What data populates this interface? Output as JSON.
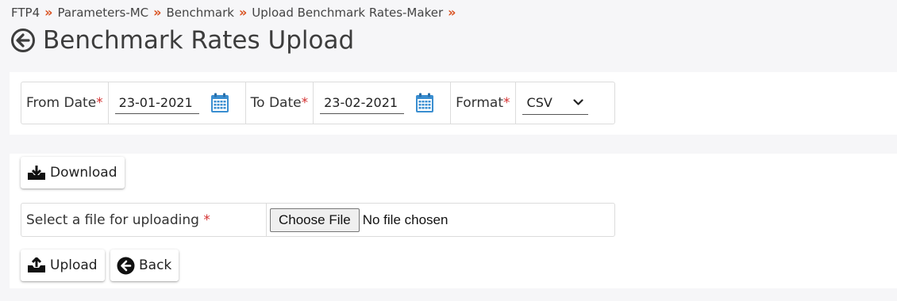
{
  "breadcrumb": {
    "items": [
      "FTP4",
      "Parameters-MC",
      "Benchmark",
      "Upload Benchmark Rates-Maker"
    ],
    "separator": "»"
  },
  "page": {
    "title": "Benchmark Rates Upload",
    "back_icon": "back-circle-icon"
  },
  "filters": {
    "from_date_label": "From Date",
    "from_date_value": "23-01-2021",
    "to_date_label": "To Date",
    "to_date_value": "23-02-2021",
    "format_label": "Format",
    "format_value": "CSV",
    "required_marker": "*"
  },
  "actions": {
    "download_label": "Download",
    "upload_label": "Upload",
    "back_label": "Back"
  },
  "file_upload": {
    "label": "Select a file for uploading",
    "required_marker": "*",
    "choose_button_label": "Choose File",
    "status_text": "No file chosen"
  },
  "colors": {
    "accent": "#d9501e",
    "required": "#d32f2f",
    "calendar": "#3a8ed0"
  }
}
